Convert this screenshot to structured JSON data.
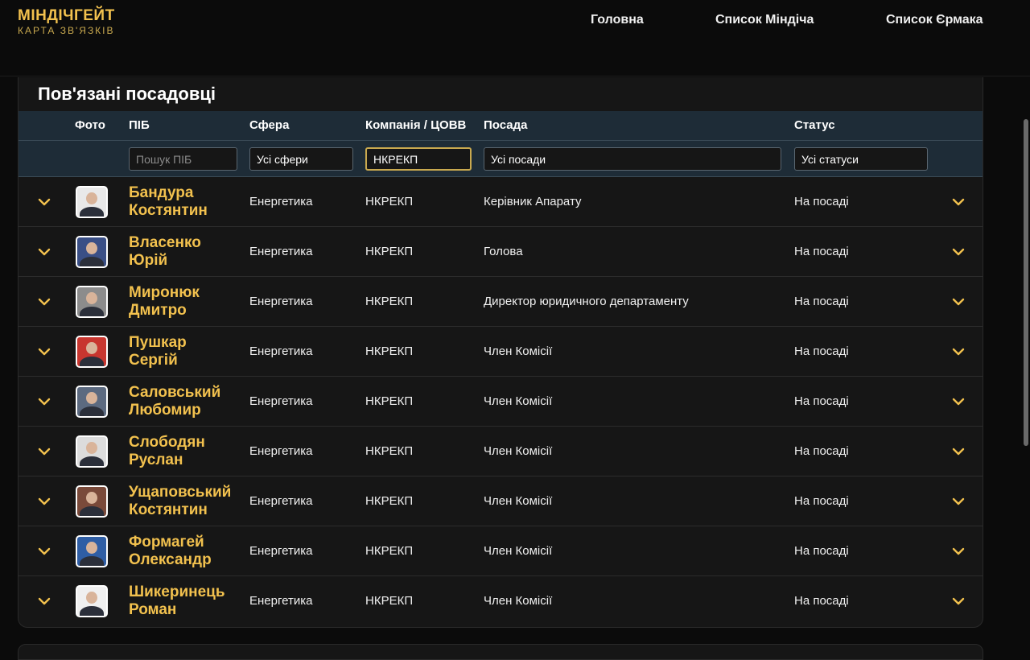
{
  "logo": {
    "title": "МІНДІЧГЕЙТ",
    "subtitle": "КАРТА ЗВ'ЯЗКІВ"
  },
  "nav": [
    {
      "label": "Головна"
    },
    {
      "label": "Список Міндіча"
    },
    {
      "label": "Список Єрмака"
    }
  ],
  "section": {
    "title": "Пов'язані посадовці"
  },
  "columns": {
    "photo": "Фото",
    "name": "ПІБ",
    "sphere": "Сфера",
    "company": "Компанія / ЦОВВ",
    "position": "Посада",
    "status": "Статус"
  },
  "filters": {
    "name_placeholder": "Пошук ПІБ",
    "sphere_value": "Усі сфери",
    "company_value": "НКРЕКП",
    "position_value": "Усі посади",
    "status_value": "Усі статуси"
  },
  "colors": {
    "accent": "#f2c14e",
    "header_bg": "#1e2c37",
    "card_bg": "#161616"
  },
  "rows": [
    {
      "name_line1": "Бандура",
      "name_line2": "Костянтин",
      "sphere": "Енергетика",
      "company": "НКРЕКП",
      "position": "Керівник Апарату",
      "status": "На посаді"
    },
    {
      "name_line1": "Власенко",
      "name_line2": "Юрій",
      "sphere": "Енергетика",
      "company": "НКРЕКП",
      "position": "Голова",
      "status": "На посаді"
    },
    {
      "name_line1": "Миронюк",
      "name_line2": "Дмитро",
      "sphere": "Енергетика",
      "company": "НКРЕКП",
      "position": "Директор юридичного департаменту",
      "status": "На посаді"
    },
    {
      "name_line1": "Пушкар",
      "name_line2": "Сергій",
      "sphere": "Енергетика",
      "company": "НКРЕКП",
      "position": "Член Комісії",
      "status": "На посаді"
    },
    {
      "name_line1": "Саловський",
      "name_line2": "Любомир",
      "sphere": "Енергетика",
      "company": "НКРЕКП",
      "position": "Член Комісії",
      "status": "На посаді"
    },
    {
      "name_line1": "Слободян",
      "name_line2": "Руслан",
      "sphere": "Енергетика",
      "company": "НКРЕКП",
      "position": "Член Комісії",
      "status": "На посаді"
    },
    {
      "name_line1": "Ущаповський",
      "name_line2": "Костянтин",
      "sphere": "Енергетика",
      "company": "НКРЕКП",
      "position": "Член Комісії",
      "status": "На посаді"
    },
    {
      "name_line1": "Формагей",
      "name_line2": "Олександр",
      "sphere": "Енергетика",
      "company": "НКРЕКП",
      "position": "Член Комісії",
      "status": "На посаді"
    },
    {
      "name_line1": "Шикеринець",
      "name_line2": "Роман",
      "sphere": "Енергетика",
      "company": "НКРЕКП",
      "position": "Член Комісії",
      "status": "На посаді"
    }
  ]
}
